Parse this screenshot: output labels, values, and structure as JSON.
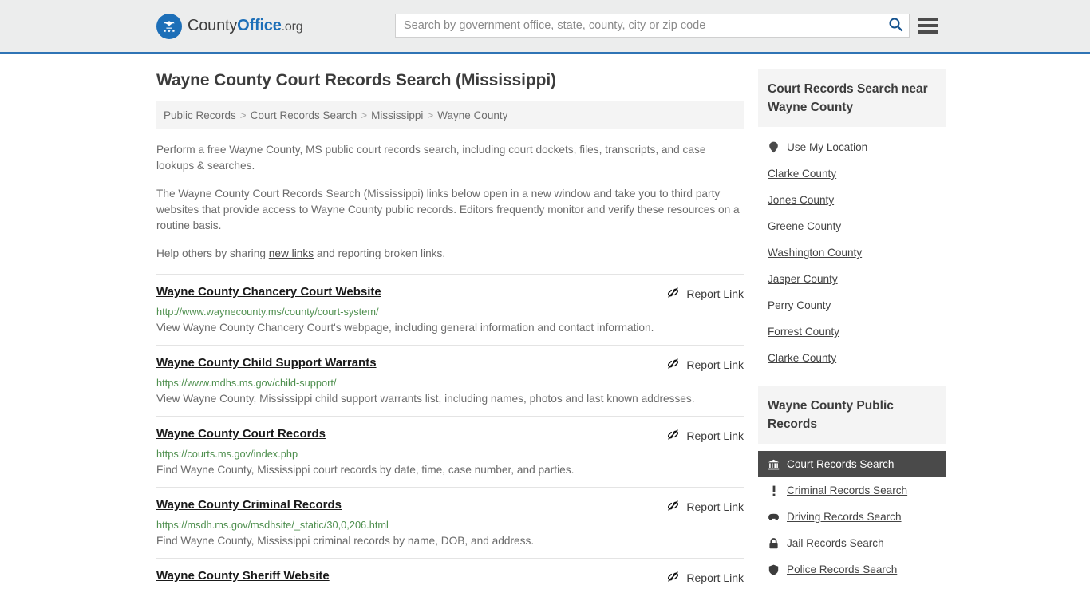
{
  "header": {
    "logo_text_1": "County",
    "logo_text_2": "Office",
    "logo_text_3": ".org",
    "logo_icon": "eagle-seal-icon",
    "search_placeholder": "Search by government office, state, county, city or zip code",
    "search_value": "",
    "search_icon": "search-icon",
    "menu_icon": "hamburger-menu-icon",
    "accent_color": "#2f74b5",
    "background_color": "#eceded"
  },
  "page": {
    "title": "Wayne County Court Records Search (Mississippi)"
  },
  "breadcrumb": {
    "items": [
      {
        "label": "Public Records"
      },
      {
        "label": "Court Records Search"
      },
      {
        "label": "Mississippi"
      },
      {
        "label": "Wayne County"
      }
    ],
    "separator": ">"
  },
  "intro": {
    "paragraph_1": "Perform a free Wayne County, MS public court records search, including court dockets, files, transcripts, and case lookups & searches.",
    "paragraph_2": "The Wayne County Court Records Search (Mississippi) links below open in a new window and take you to third party websites that provide access to Wayne County public records. Editors frequently monitor and verify these resources on a routine basis.",
    "paragraph_3_before": "Help others by sharing ",
    "paragraph_3_link": "new links",
    "paragraph_3_after": " and reporting broken links."
  },
  "results": {
    "report_label": "Report Link",
    "report_icon": "broken-link-icon",
    "items": [
      {
        "title": "Wayne County Chancery Court Website",
        "url": "http://www.waynecounty.ms/county/court-system/",
        "description": "View Wayne County Chancery Court's webpage, including general information and contact information."
      },
      {
        "title": "Wayne County Child Support Warrants",
        "url": "https://www.mdhs.ms.gov/child-support/",
        "description": "View Wayne County, Mississippi child support warrants list, including names, photos and last known addresses."
      },
      {
        "title": "Wayne County Court Records",
        "url": "https://courts.ms.gov/index.php",
        "description": "Find Wayne County, Mississippi court records by date, time, case number, and parties."
      },
      {
        "title": "Wayne County Criminal Records",
        "url": "https://msdh.ms.gov/msdhsite/_static/30,0,206.html",
        "description": "Find Wayne County, Mississippi criminal records by name, DOB, and address."
      },
      {
        "title": "Wayne County Sheriff Website",
        "url": "",
        "description": ""
      }
    ]
  },
  "sidebar": {
    "nearby": {
      "heading": "Court Records Search near Wayne County",
      "items": [
        {
          "label": "Use My Location",
          "icon": "location-pin-icon"
        },
        {
          "label": "Clarke County",
          "icon": ""
        },
        {
          "label": "Jones County",
          "icon": ""
        },
        {
          "label": "Greene County",
          "icon": ""
        },
        {
          "label": "Washington County",
          "icon": ""
        },
        {
          "label": "Jasper County",
          "icon": ""
        },
        {
          "label": "Perry County",
          "icon": ""
        },
        {
          "label": "Forrest County",
          "icon": ""
        },
        {
          "label": "Clarke County",
          "icon": ""
        }
      ]
    },
    "public_records": {
      "heading": "Wayne County Public Records",
      "items": [
        {
          "label": "Court Records Search",
          "icon": "courthouse-icon",
          "active": true
        },
        {
          "label": "Criminal Records Search",
          "icon": "exclamation-icon",
          "active": false
        },
        {
          "label": "Driving Records Search",
          "icon": "car-icon",
          "active": false
        },
        {
          "label": "Jail Records Search",
          "icon": "lock-icon",
          "active": false
        },
        {
          "label": "Police Records Search",
          "icon": "shield-icon",
          "active": false
        }
      ]
    }
  }
}
